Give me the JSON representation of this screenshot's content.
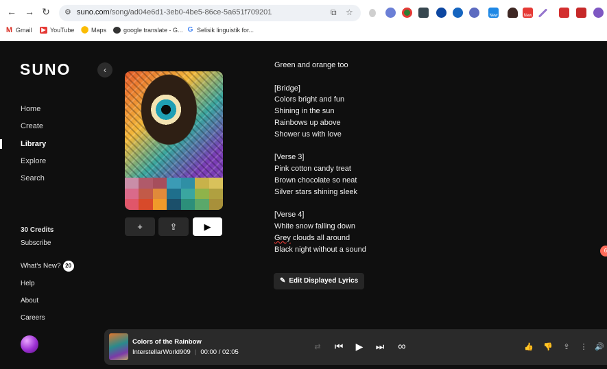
{
  "browser": {
    "url_host": "suno.com",
    "url_path": "/song/ad04e6d1-3eb0-4be5-86ce-5a651f709201",
    "bookmarks": [
      "Gmail",
      "YouTube",
      "Maps",
      "google translate - G...",
      "Selisik linguistik for..."
    ],
    "extension_badges": [
      "New",
      "New"
    ]
  },
  "sidebar": {
    "logo": "SUNO",
    "nav": [
      "Home",
      "Create",
      "Library",
      "Explore",
      "Search"
    ],
    "active": "Library",
    "credits": "30 Credits",
    "subscribe": "Subscribe",
    "whats_new": "What's New?",
    "whats_new_count": "20",
    "help": "Help",
    "about": "About",
    "careers": "Careers"
  },
  "song_controls": {
    "add": "+",
    "share": "⇪",
    "play": "▶"
  },
  "lyrics": [
    "Green and orange too",
    "",
    "[Bridge]",
    "Colors bright and fun",
    "Shining in the sun",
    "Rainbows up above",
    "Shower us with love",
    "",
    "[Verse 3]",
    "Pink cotton candy treat",
    "Brown chocolate so neat",
    "Silver stars shining sleek",
    "",
    "[Verse 4]",
    "White snow falling down",
    "Grey clouds all around",
    "Black night without a sound"
  ],
  "edit_lyrics_label": "Edit Displayed Lyrics",
  "notification_count": "6",
  "palette_colors": [
    "#c98ea8",
    "#b05a6a",
    "#a64e5c",
    "#3b9bb5",
    "#2f8fa5",
    "#c8b24a",
    "#d9c25b",
    "#d96a8a",
    "#c25a48",
    "#e08a3a",
    "#1f6f8c",
    "#3aa6a0",
    "#8fb34a",
    "#b0a040",
    "#e0566a",
    "#d84a2a",
    "#f09a2a",
    "#1b4f6a",
    "#2c8f7a",
    "#5aa86a",
    "#a8903a"
  ],
  "player": {
    "title": "Colors of the Rainbow",
    "artist": "InterstellarWorld909",
    "time": "00:00 / 02:05"
  }
}
